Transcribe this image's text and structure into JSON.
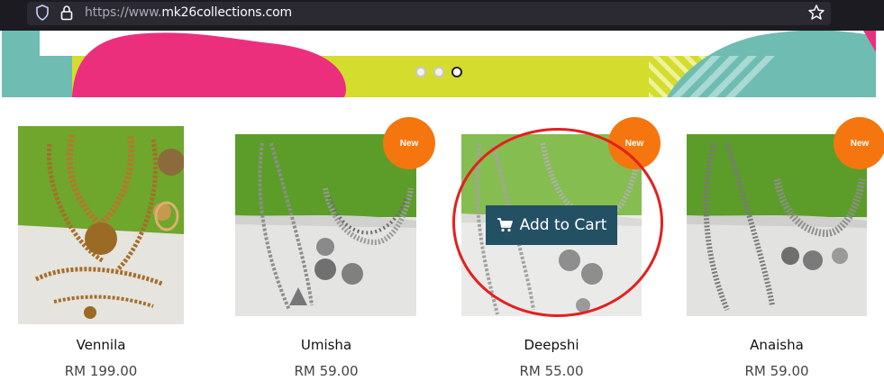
{
  "browser": {
    "url_prefix": "https://www.",
    "url_domain": "mk26collections.com"
  },
  "banner": {
    "slide_count": 3,
    "active_slide": 3
  },
  "products": [
    {
      "name": "Vennila",
      "price": "RM 199.00",
      "badge": ""
    },
    {
      "name": "Umisha",
      "price": "RM 59.00",
      "badge": "New"
    },
    {
      "name": "Deepshi",
      "price": "RM 55.00",
      "badge": "New"
    },
    {
      "name": "Anaisha",
      "price": "RM 59.00",
      "badge": "New"
    }
  ],
  "cart_button": {
    "label": "Add to Cart"
  },
  "colors": {
    "badge": "#f5760f",
    "cart_button": "#245064",
    "highlight": "#e3201f",
    "banner_pink": "#ec2f7d",
    "banner_lime": "#d4dc2e",
    "banner_teal": "#6fbcb3"
  }
}
